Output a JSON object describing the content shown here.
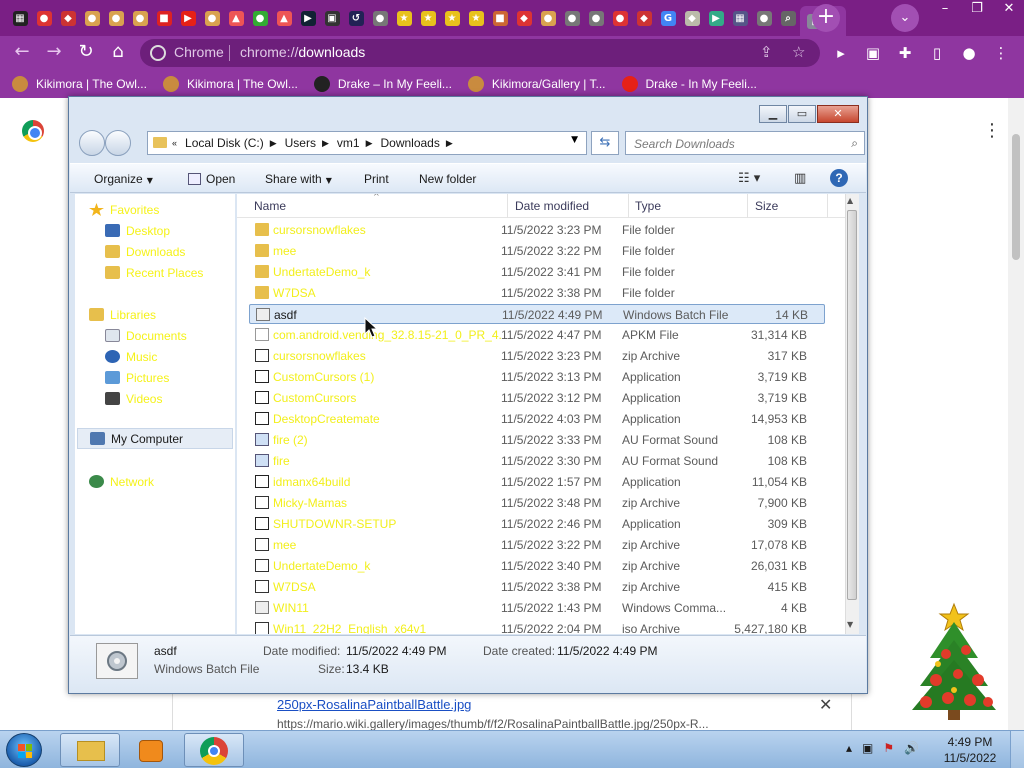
{
  "chrome": {
    "tabs": [
      {
        "color": "#222",
        "glyph": "▦"
      },
      {
        "color": "#d33",
        "glyph": "●"
      },
      {
        "color": "#c33",
        "glyph": "◆"
      },
      {
        "color": "#d9a24f",
        "glyph": "●"
      },
      {
        "color": "#d9a24f",
        "glyph": "●"
      },
      {
        "color": "#d9a24f",
        "glyph": "●"
      },
      {
        "color": "#d22",
        "glyph": "■"
      },
      {
        "color": "#e62117",
        "glyph": "▶"
      },
      {
        "color": "#d9a24f",
        "glyph": "●"
      },
      {
        "color": "#e55",
        "glyph": "▲"
      },
      {
        "color": "#3a3",
        "glyph": "●"
      },
      {
        "color": "#e55",
        "glyph": "▲"
      },
      {
        "color": "#123",
        "glyph": "▶"
      },
      {
        "color": "#333",
        "glyph": "▣"
      },
      {
        "color": "#225",
        "glyph": "↺"
      },
      {
        "color": "#777",
        "glyph": "●"
      },
      {
        "color": "#e8c21c",
        "glyph": "★"
      },
      {
        "color": "#e8c21c",
        "glyph": "★"
      },
      {
        "color": "#e8c21c",
        "glyph": "★"
      },
      {
        "color": "#e8c21c",
        "glyph": "★"
      },
      {
        "color": "#c63",
        "glyph": "■"
      },
      {
        "color": "#d33",
        "glyph": "◆"
      },
      {
        "color": "#d9a24f",
        "glyph": "●"
      },
      {
        "color": "#777",
        "glyph": "●"
      },
      {
        "color": "#777",
        "glyph": "●"
      },
      {
        "color": "#d33",
        "glyph": "●"
      },
      {
        "color": "#c33",
        "glyph": "◆"
      },
      {
        "color": "#4285f4",
        "glyph": "G"
      },
      {
        "color": "#bba",
        "glyph": "◆"
      },
      {
        "color": "#3a8",
        "glyph": "▶"
      },
      {
        "color": "#558",
        "glyph": "▦"
      },
      {
        "color": "#777",
        "glyph": "●"
      },
      {
        "color": "#666",
        "glyph": "⌕"
      },
      {
        "color": "#889",
        "glyph": "▯"
      }
    ],
    "new_tab": "+",
    "tab_search": "⌄",
    "omnibox": {
      "chip": "Chrome",
      "url_scheme": "chrome://",
      "url_path": "downloads"
    },
    "bookmarks": [
      {
        "label": "Kikimora | The Owl...",
        "color": "#c98b3f"
      },
      {
        "label": "Kikimora | The Owl...",
        "color": "#c98b3f"
      },
      {
        "label": "Drake – In My Feeli...",
        "color": "#222"
      },
      {
        "label": "Kikimora/Gallery | T...",
        "color": "#c98b3f"
      },
      {
        "label": "Drake - In My Feeli...",
        "color": "#e62117"
      }
    ]
  },
  "downloads_page": {
    "link": "250px-RosalinaPaintballBattle.jpg",
    "url": "https://mario.wiki.gallery/images/thumb/f/f2/RosalinaPaintballBattle.jpg/250px-R..."
  },
  "explorer": {
    "breadcrumbs": [
      "Local Disk (C:)",
      "Users",
      "vm1",
      "Downloads"
    ],
    "search_placeholder": "Search Downloads",
    "commands": {
      "organize": "Organize",
      "open": "Open",
      "share": "Share with",
      "print": "Print",
      "new_folder": "New folder"
    },
    "columns": {
      "name": "Name",
      "date": "Date modified",
      "type": "Type",
      "size": "Size"
    },
    "nav": {
      "favorites": "Favorites",
      "desktop": "Desktop",
      "downloads": "Downloads",
      "recent": "Recent Places",
      "libraries": "Libraries",
      "documents": "Documents",
      "music": "Music",
      "pictures": "Pictures",
      "videos": "Videos",
      "computer": "My Computer",
      "network": "Network"
    },
    "files": [
      {
        "name": "cursorsnowflakes",
        "date": "11/5/2022 3:23 PM",
        "type": "File folder",
        "size": "",
        "icon": "folder"
      },
      {
        "name": "mee",
        "date": "11/5/2022 3:22 PM",
        "type": "File folder",
        "size": "",
        "icon": "folder"
      },
      {
        "name": "UndertateDemo_k",
        "date": "11/5/2022 3:41 PM",
        "type": "File folder",
        "size": "",
        "icon": "folder"
      },
      {
        "name": "W7DSA",
        "date": "11/5/2022 3:38 PM",
        "type": "File folder",
        "size": "",
        "icon": "folder"
      },
      {
        "name": "asdf",
        "date": "11/5/2022 4:49 PM",
        "type": "Windows Batch File",
        "size": "14 KB",
        "icon": "bat",
        "selected": true
      },
      {
        "name": "com.android.vending_32.8.15-21_0_PR_4...",
        "date": "11/5/2022 4:47 PM",
        "type": "APKM File",
        "size": "31,314 KB",
        "icon": "file"
      },
      {
        "name": "cursorsnowflakes",
        "date": "11/5/2022 3:23 PM",
        "type": "zip Archive",
        "size": "317 KB",
        "icon": "zip"
      },
      {
        "name": "CustomCursors (1)",
        "date": "11/5/2022 3:13 PM",
        "type": "Application",
        "size": "3,719 KB",
        "icon": "app"
      },
      {
        "name": "CustomCursors",
        "date": "11/5/2022 3:12 PM",
        "type": "Application",
        "size": "3,719 KB",
        "icon": "app"
      },
      {
        "name": "DesktopCreatemate",
        "date": "11/5/2022 4:03 PM",
        "type": "Application",
        "size": "14,953 KB",
        "icon": "app"
      },
      {
        "name": "fire (2)",
        "date": "11/5/2022 3:33 PM",
        "type": "AU Format Sound",
        "size": "108 KB",
        "icon": "sound"
      },
      {
        "name": "fire",
        "date": "11/5/2022 3:30 PM",
        "type": "AU Format Sound",
        "size": "108 KB",
        "icon": "sound"
      },
      {
        "name": "idmanx64build",
        "date": "11/5/2022 1:57 PM",
        "type": "Application",
        "size": "11,054 KB",
        "icon": "app"
      },
      {
        "name": "Micky-Mamas",
        "date": "11/5/2022 3:48 PM",
        "type": "zip Archive",
        "size": "7,900 KB",
        "icon": "zip"
      },
      {
        "name": "SHUTDOWNR-SETUP",
        "date": "11/5/2022 2:46 PM",
        "type": "Application",
        "size": "309 KB",
        "icon": "app"
      },
      {
        "name": "mee",
        "date": "11/5/2022 3:22 PM",
        "type": "zip Archive",
        "size": "17,078 KB",
        "icon": "zip"
      },
      {
        "name": "UndertateDemo_k",
        "date": "11/5/2022 3:40 PM",
        "type": "zip Archive",
        "size": "26,031 KB",
        "icon": "zip"
      },
      {
        "name": "W7DSA",
        "date": "11/5/2022 3:38 PM",
        "type": "zip Archive",
        "size": "415 KB",
        "icon": "zip"
      },
      {
        "name": "WIN11",
        "date": "11/5/2022 1:43 PM",
        "type": "Windows Comma...",
        "size": "4 KB",
        "icon": "bat"
      },
      {
        "name": "Win11_22H2_English_x64v1",
        "date": "11/5/2022 2:04 PM",
        "type": "iso Archive",
        "size": "5,427,180 KB",
        "icon": "zip"
      }
    ],
    "details": {
      "name": "asdf",
      "type": "Windows Batch File",
      "modified_label": "Date modified:",
      "modified": "11/5/2022 4:49 PM",
      "created_label": "Date created:",
      "created": "11/5/2022 4:49 PM",
      "size_label": "Size:",
      "size": "13.4 KB"
    }
  },
  "taskbar": {
    "time": "4:49 PM",
    "date": "11/5/2022"
  }
}
